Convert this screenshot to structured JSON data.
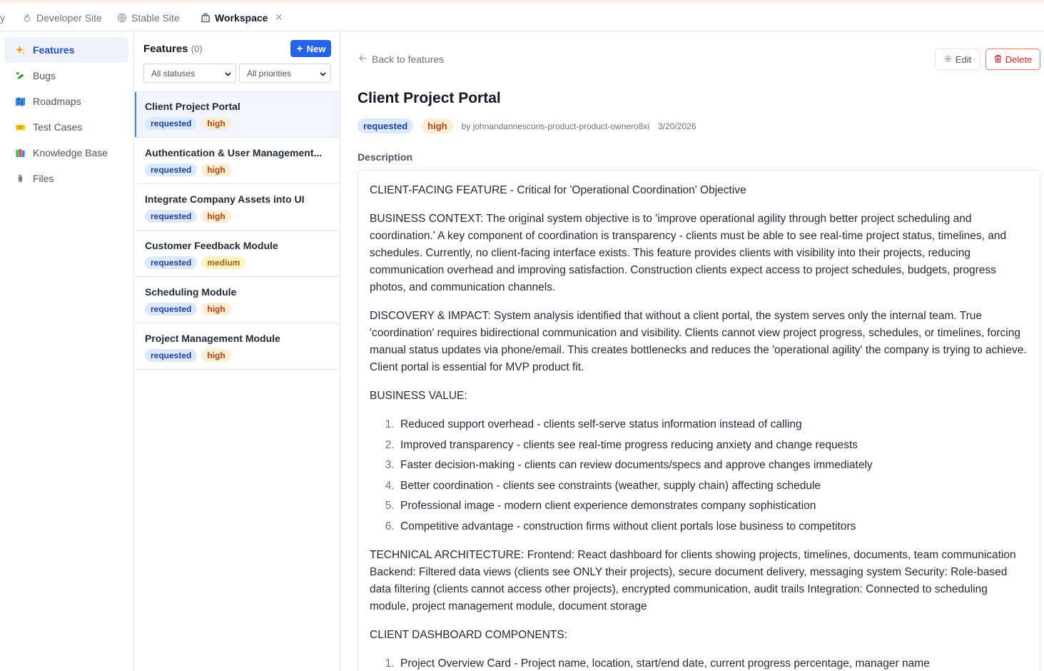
{
  "tabs": [
    {
      "label": "y",
      "icon": "none"
    },
    {
      "label": "Developer Site",
      "icon": "flame-icon"
    },
    {
      "label": "Stable Site",
      "icon": "globe-icon"
    },
    {
      "label": "Workspace",
      "icon": "building-icon",
      "active": true
    }
  ],
  "sidebar": {
    "items": [
      {
        "label": "Features",
        "icon": "sparkles-icon",
        "active": true
      },
      {
        "label": "Bugs",
        "icon": "bug-icon"
      },
      {
        "label": "Roadmaps",
        "icon": "map-icon"
      },
      {
        "label": "Test Cases",
        "icon": "ticket-icon"
      },
      {
        "label": "Knowledge Base",
        "icon": "books-icon"
      },
      {
        "label": "Files",
        "icon": "paperclip-icon"
      }
    ]
  },
  "list": {
    "title": "Features",
    "count": "(0)",
    "new_label": "New",
    "status_filter": "All statuses",
    "priority_filter": "All priorities",
    "items": [
      {
        "name": "Client Project Portal",
        "status": "requested",
        "priority": "high"
      },
      {
        "name": "Authentication & User Management...",
        "status": "requested",
        "priority": "high"
      },
      {
        "name": "Integrate Company Assets into UI",
        "status": "requested",
        "priority": "high"
      },
      {
        "name": "Customer Feedback Module",
        "status": "requested",
        "priority": "medium"
      },
      {
        "name": "Scheduling Module",
        "status": "requested",
        "priority": "high"
      },
      {
        "name": "Project Management Module",
        "status": "requested",
        "priority": "high"
      }
    ]
  },
  "detail": {
    "back_label": "Back to features",
    "edit_label": "Edit",
    "delete_label": "Delete",
    "title": "Client Project Portal",
    "status": "requested",
    "priority": "high",
    "author": "by johnandannescons-product-product-ownero8xi",
    "date": "3/20/2026",
    "description_label": "Description",
    "desc": {
      "p1": "CLIENT-FACING FEATURE - Critical for 'Operational Coordination' Objective",
      "p2": "BUSINESS CONTEXT: The original system objective is to 'improve operational agility through better project scheduling and coordination.' A key component of coordination is transparency - clients must be able to see real-time project status, timelines, and schedules. Currently, no client-facing interface exists. This feature provides clients with visibility into their projects, reducing communication overhead and improving satisfaction. Construction clients expect access to project schedules, budgets, progress photos, and communication channels.",
      "p3": "DISCOVERY & IMPACT: System analysis identified that without a client portal, the system serves only the internal team. True 'coordination' requires bidirectional communication and visibility. Clients cannot view project progress, schedules, or timelines, forcing manual status updates via phone/email. This creates bottlenecks and reduces the 'operational agility' the company is trying to achieve. Client portal is essential for MVP product fit.",
      "p4": "BUSINESS VALUE:",
      "values": [
        "Reduced support overhead - clients self-serve status information instead of calling",
        "Improved transparency - clients see real-time progress reducing anxiety and change requests",
        "Faster decision-making - clients can review documents/specs and approve changes immediately",
        "Better coordination - clients see constraints (weather, supply chain) affecting schedule",
        "Professional image - modern client experience demonstrates company sophistication",
        "Competitive advantage - construction firms without client portals lose business to competitors"
      ],
      "p5": "TECHNICAL ARCHITECTURE: Frontend: React dashboard for clients showing projects, timelines, documents, team communication Backend: Filtered data views (clients see ONLY their projects), secure document delivery, messaging system Security: Role-based data filtering (clients cannot access other projects), encrypted communication, audit trails Integration: Connected to scheduling module, project management module, document storage",
      "p6": "CLIENT DASHBOARD COMPONENTS:",
      "components": [
        "Project Overview Card - Project name, location, start/end date, current progress percentage, manager name"
      ]
    }
  }
}
